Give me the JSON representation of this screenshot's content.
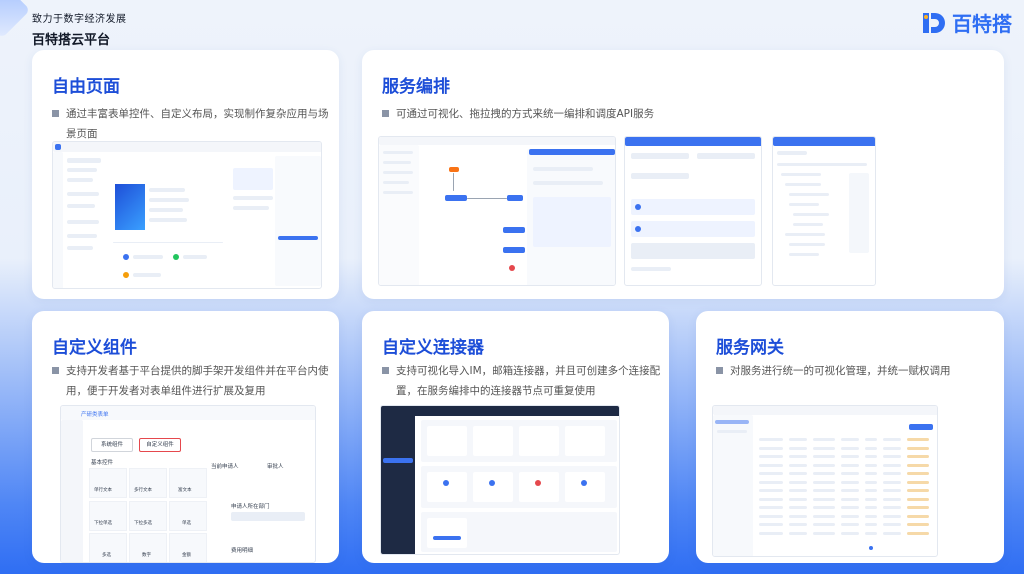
{
  "header": {
    "subtitle": "致力于数字经济发展",
    "title": "百特搭云平台"
  },
  "brand": {
    "name": "百特搭",
    "color": "#2f6ef3"
  },
  "cards": {
    "free_page": {
      "title": "自由页面",
      "desc": "通过丰富表单控件、自定义布局，实现制作复杂应用与场景页面"
    },
    "orchestration": {
      "title": "服务编排",
      "desc": "可通过可视化、拖拉拽的方式来统一编排和调度API服务"
    },
    "custom_component": {
      "title": "自定义组件",
      "desc": "支持开发者基于平台提供的脚手架开发组件并在平台内使用，便于开发者对表单组件进行扩展及复用"
    },
    "custom_connector": {
      "title": "自定义连接器",
      "desc": "支持可视化导入IM，邮箱连接器，并且可创建多个连接配置，在服务编排中的连接器节点可重复使用"
    },
    "gateway": {
      "title": "服务网关",
      "desc": "对服务进行统一的可视化管理，并统一赋权调用"
    }
  },
  "component_mock": {
    "breadcrumb": "产研类表单",
    "tab_system": "系统组件",
    "tab_custom": "自定义组件",
    "section": "基本控件",
    "items": [
      "单行文本",
      "多行文本",
      "富文本",
      "下拉单选",
      "下拉多选",
      "单选",
      "多选",
      "数字",
      "金额"
    ],
    "field1": "当前申请人",
    "field2": "审批人",
    "field3": "申请人所在部门",
    "field4": "费用明细"
  },
  "colors": {
    "accent": "#1d4ed8",
    "primary": "#3b72f0",
    "highlight_red": "#e5484d"
  }
}
